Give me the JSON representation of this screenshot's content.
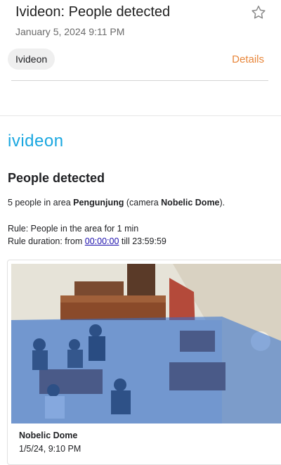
{
  "email": {
    "subject": "Ivideon: People detected",
    "date": "January 5, 2024  9:11 PM",
    "sender": "Ivideon",
    "details_label": "Details",
    "star_icon": "star-outline-icon"
  },
  "body": {
    "logo": "ivideon",
    "heading": "People detected",
    "summary": {
      "prefix": "5 people in area ",
      "area": "Pengunjung",
      "middle": " (camera ",
      "camera": "Nobelic Dome",
      "suffix": ")."
    },
    "rule": {
      "line1": "Rule: People in the area for 1 min",
      "prefix": "Rule duration: from ",
      "from": "00:00:00",
      "till_word": " till ",
      "till": "23:59:59"
    }
  },
  "card": {
    "camera_name": "Nobelic Dome",
    "timestamp": "1/5/24, 9:10 PM"
  },
  "colors": {
    "accent_orange": "#e8863a",
    "logo_blue": "#1aa7e0",
    "zone_overlay": "#2f6fd1"
  }
}
